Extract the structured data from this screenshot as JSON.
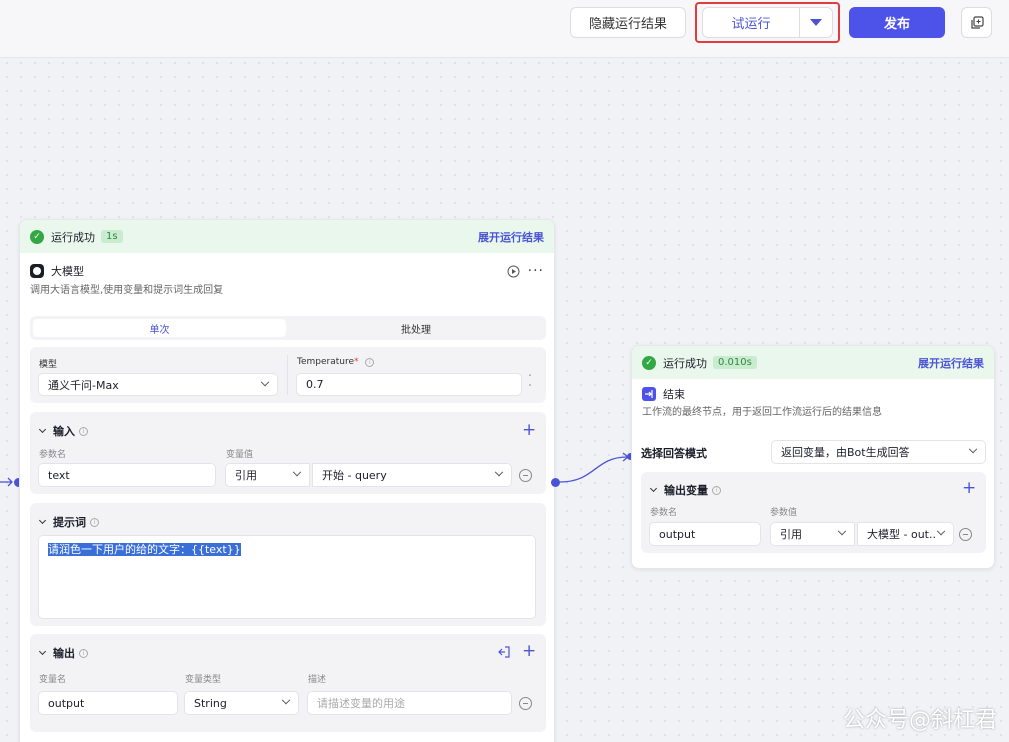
{
  "topbar": {
    "hide_results": "隐藏运行结果",
    "test_run": "试运行",
    "publish": "发布"
  },
  "llm_node": {
    "status": "运行成功",
    "duration": "1s",
    "expand": "展开运行结果",
    "title": "大模型",
    "description": "调用大语言模型,使用变量和提示词生成回复",
    "tabs": [
      "单次",
      "批处理"
    ],
    "model_label": "模型",
    "model_value": "通义千问-Max",
    "temperature_label": "Temperature",
    "temperature_required": "*",
    "temperature_value": "0.7",
    "input": {
      "title": "输入",
      "col_name": "参数名",
      "col_value": "变量值",
      "param_name": "text",
      "ref_type": "引用",
      "ref_value": "开始 - query"
    },
    "prompt": {
      "title": "提示词",
      "text": "请润色一下用户的给的文字：{{text}}"
    },
    "output": {
      "title": "输出",
      "col_name": "变量名",
      "col_type": "变量类型",
      "col_desc": "描述",
      "var_name": "output",
      "var_type": "String",
      "desc_placeholder": "请描述变量的用途"
    }
  },
  "end_node": {
    "status": "运行成功",
    "duration": "0.010s",
    "expand": "展开运行结果",
    "title": "结束",
    "description": "工作流的最终节点，用于返回工作流运行后的结果信息",
    "mode_label": "选择回答模式",
    "mode_value": "返回变量，由Bot生成回答",
    "output_vars": {
      "title": "输出变量",
      "col_name": "参数名",
      "col_value": "参数值",
      "param_name": "output",
      "ref_type": "引用",
      "ref_value": "大模型 - out..."
    }
  },
  "watermark": "公众号@斜杠君",
  "colors": {
    "accent": "#4d53e8",
    "success": "#32a845",
    "highlight": "#e03c3c"
  }
}
